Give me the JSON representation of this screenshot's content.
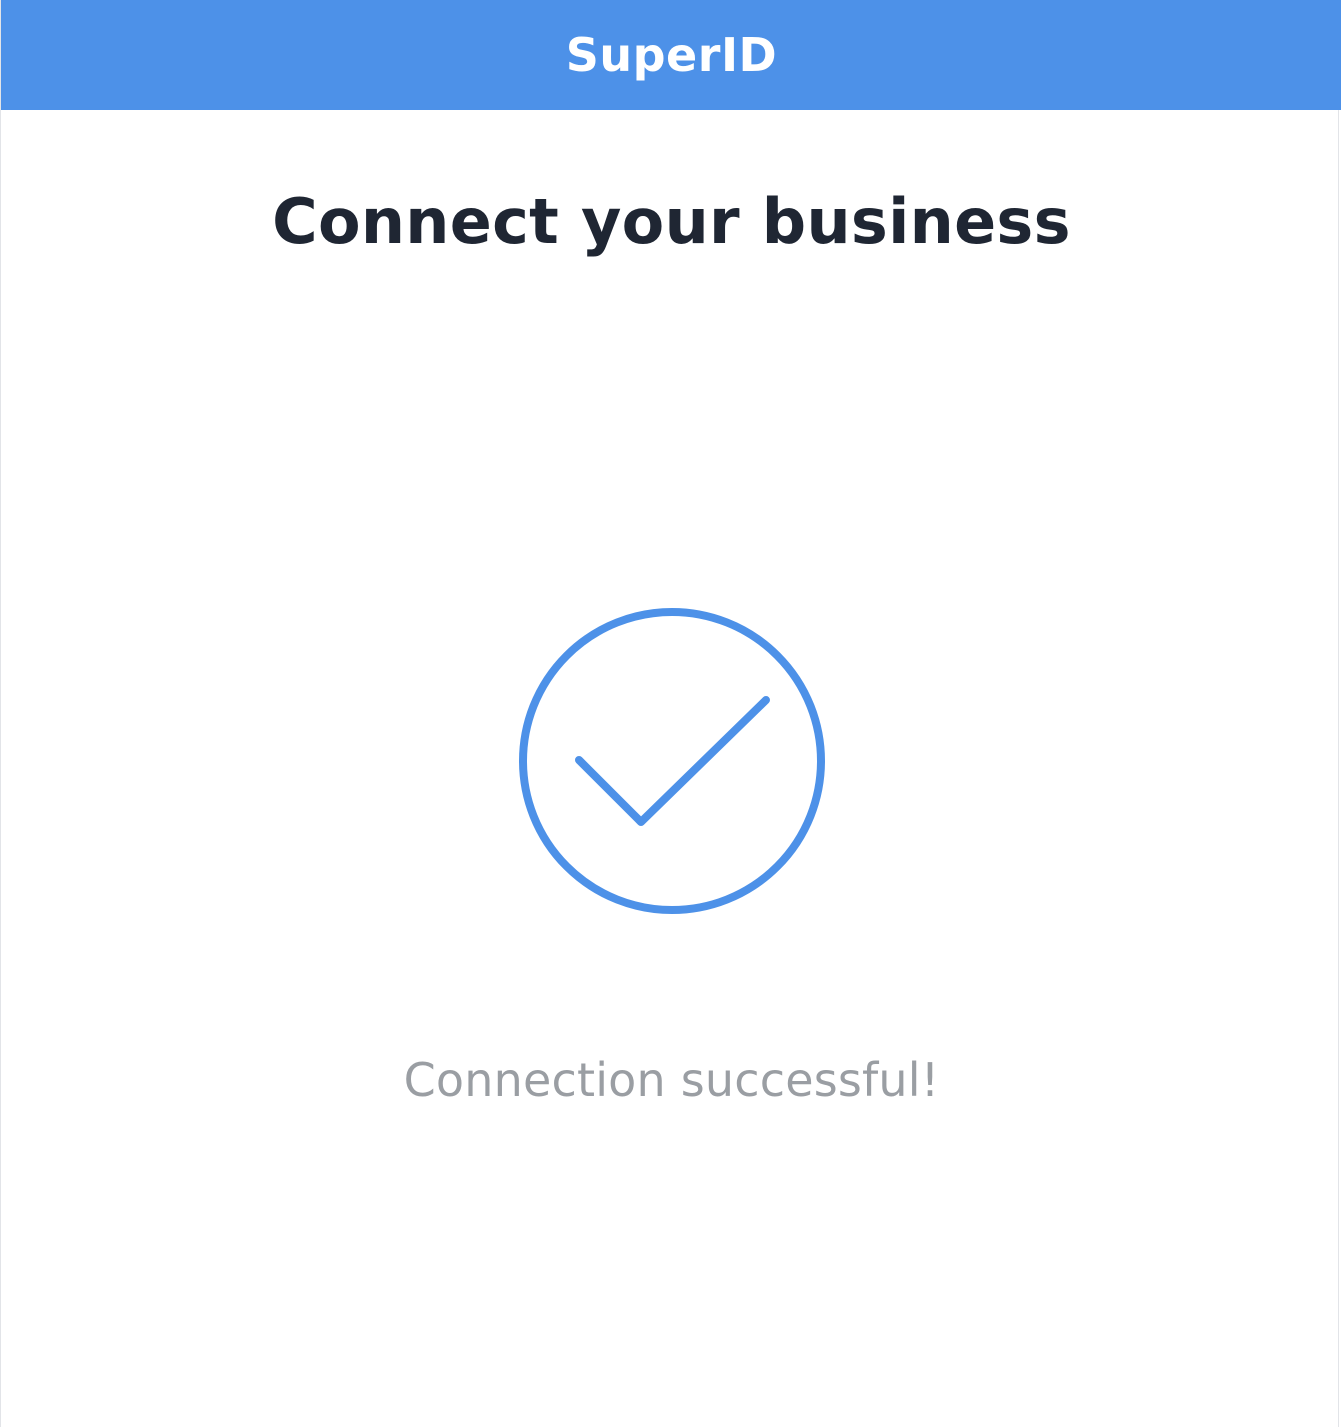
{
  "header": {
    "brand": "SuperID",
    "color": "#4d91e8"
  },
  "main": {
    "title": "Connect your business",
    "status_icon": "check-circle-icon",
    "status_text": "Connection successful!"
  },
  "colors": {
    "accent": "#4d91e8",
    "title_text": "#1f2633",
    "muted_text": "#9a9ea3",
    "background": "#ffffff"
  }
}
